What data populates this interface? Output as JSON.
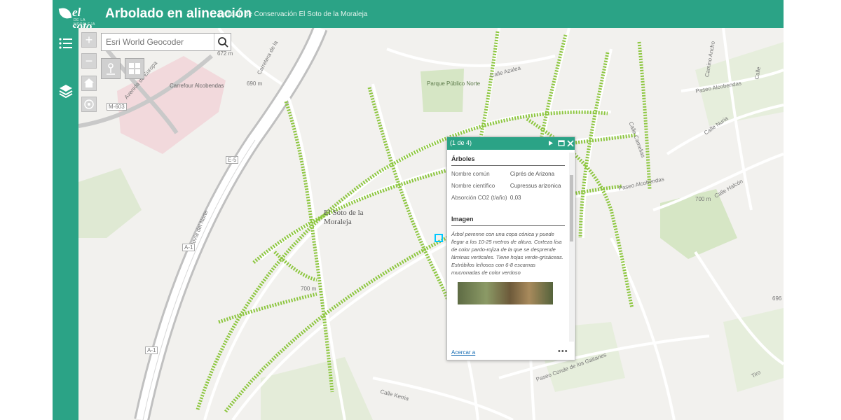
{
  "header": {
    "logo_text": "el soto",
    "logo_sub": "DE LA MORALEJA",
    "title": "Arbolado en alineación",
    "subtitle": "Entidad de Conservación El Soto de la Moraleja",
    "background_color": "#2ba386"
  },
  "sidebar": {
    "items": [
      {
        "icon": "legend-list-icon"
      },
      {
        "icon": "layers-icon"
      }
    ]
  },
  "map_controls": {
    "zoom_in": "+",
    "zoom_out": "−",
    "home_icon": "home-icon",
    "locate_icon": "locate-icon"
  },
  "search": {
    "placeholder": "Esri World Geocoder"
  },
  "map_labels": {
    "place_name": "El Soto de la Moraleja",
    "carrefour": "Carrefour Alcobendas",
    "park": "Parque Público Norte",
    "calle_azalea": "Calle Azalea",
    "paseo_alcobendas": "Paseo Alcobendas",
    "calle_nuria": "Calle Nuria",
    "calle_camelias": "Calle Camelias",
    "paseo_alcobendas_2": "Paseo Alcobendas",
    "calle_halcon": "Calle Halcón",
    "calle_kerria": "Calle Kerria",
    "paseo_conde": "Paseo Conde de los Gaitanes",
    "autovia": "Autovía del Norte",
    "avenida": "Avenida de Europa",
    "m603": "M-603",
    "a1": "A-1",
    "a1_2": "A-1",
    "e5": "E-5",
    "cerrada": "Carretera de la",
    "camino_ancho": "Camino Ancho",
    "elev_700a": "700 m",
    "elev_700b": "700 m",
    "elev_672": "672 m",
    "elev_690": "690 m",
    "elev_696": "696",
    "calle_nuria_2": "Calle",
    "calle_tiro": "Tiro"
  },
  "colors": {
    "tree_point": "#8cc63e",
    "tree_point_dark": "#4a8a1e",
    "road": "#ffffff",
    "highway": "#b7b7b7",
    "green_area": "#d6e6c5",
    "commercial": "#f2d9dc",
    "link": "#1a6fb5"
  },
  "popup": {
    "count": "(1 de 4)",
    "section_trees": "Árboles",
    "attributes": [
      {
        "key": "Nombre común",
        "value": "Ciprés de Arizona"
      },
      {
        "key": "Nombre científico",
        "value": "Cupressus arizonica"
      },
      {
        "key": "Absorción CO2 (t/año)",
        "value": "0,03"
      }
    ],
    "section_image": "Imagen",
    "description": "Árbol perenne con una copa cónica y puede llegar a los 10-25 metros de altura. Corteza lisa de color pardo-rojiza de la que se desprende láminas verticales. Tiene hojas verde-grisáceas. Estróbilos leñosos con 6-8 escamas mucronadas de color verdoso",
    "zoom_link": "Acercar a",
    "more": "•••"
  }
}
